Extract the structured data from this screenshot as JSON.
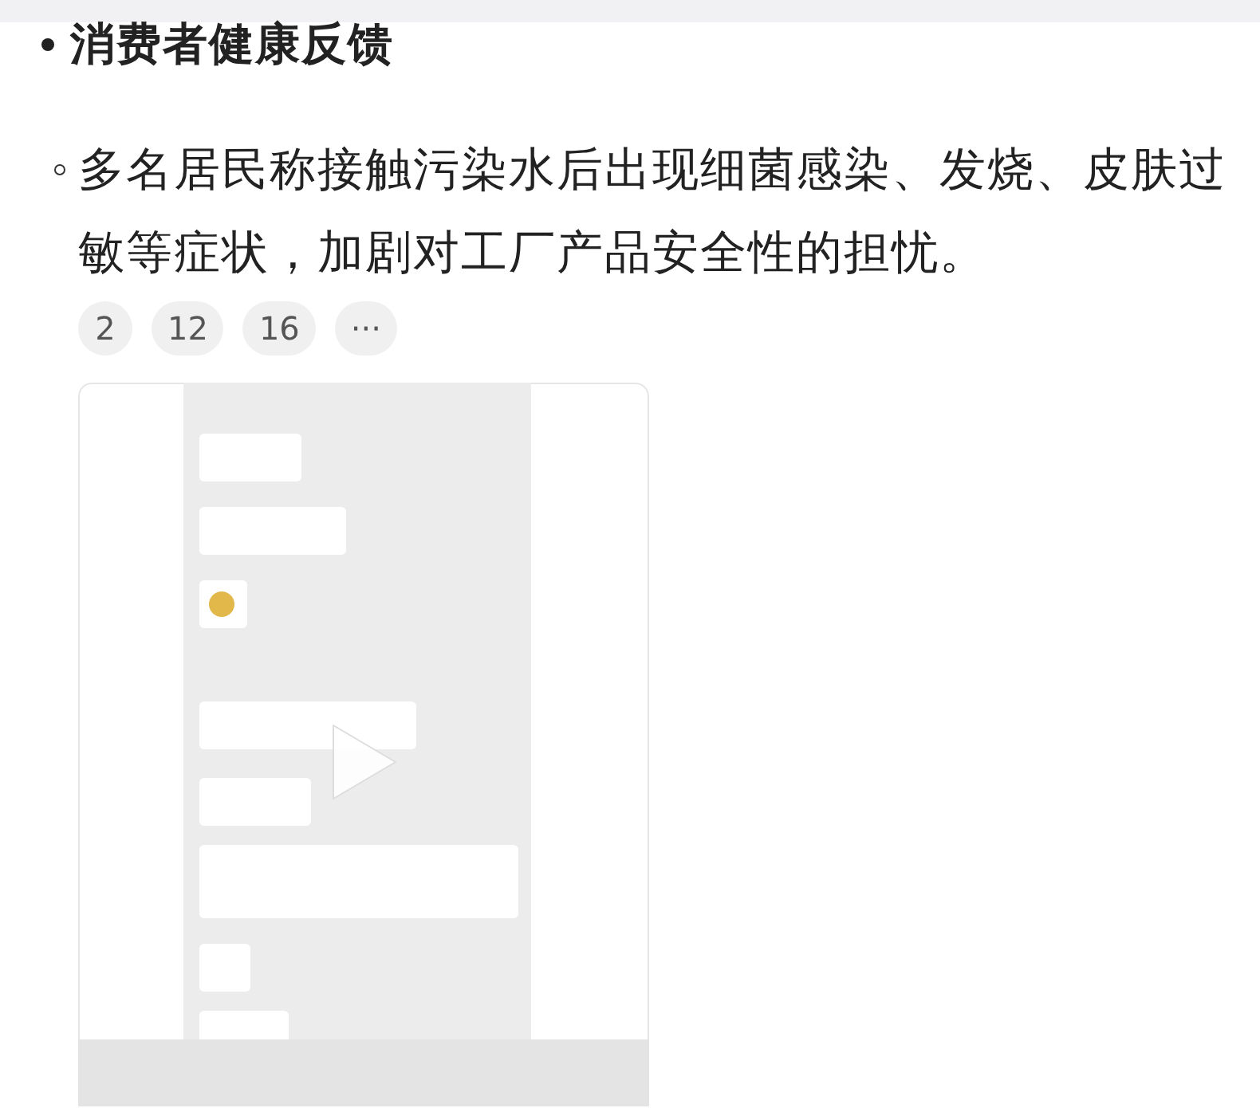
{
  "section": {
    "heading": "消费者健康反馈",
    "items": [
      {
        "text": "多名居民称接触污染水后出现细菌感染、发烧、皮肤过敏等症状，加剧对工厂产品安全性的担忧。",
        "badges": [
          {
            "label": "2"
          },
          {
            "label": "12"
          },
          {
            "label": "16"
          },
          {
            "label": "···"
          }
        ]
      }
    ]
  }
}
